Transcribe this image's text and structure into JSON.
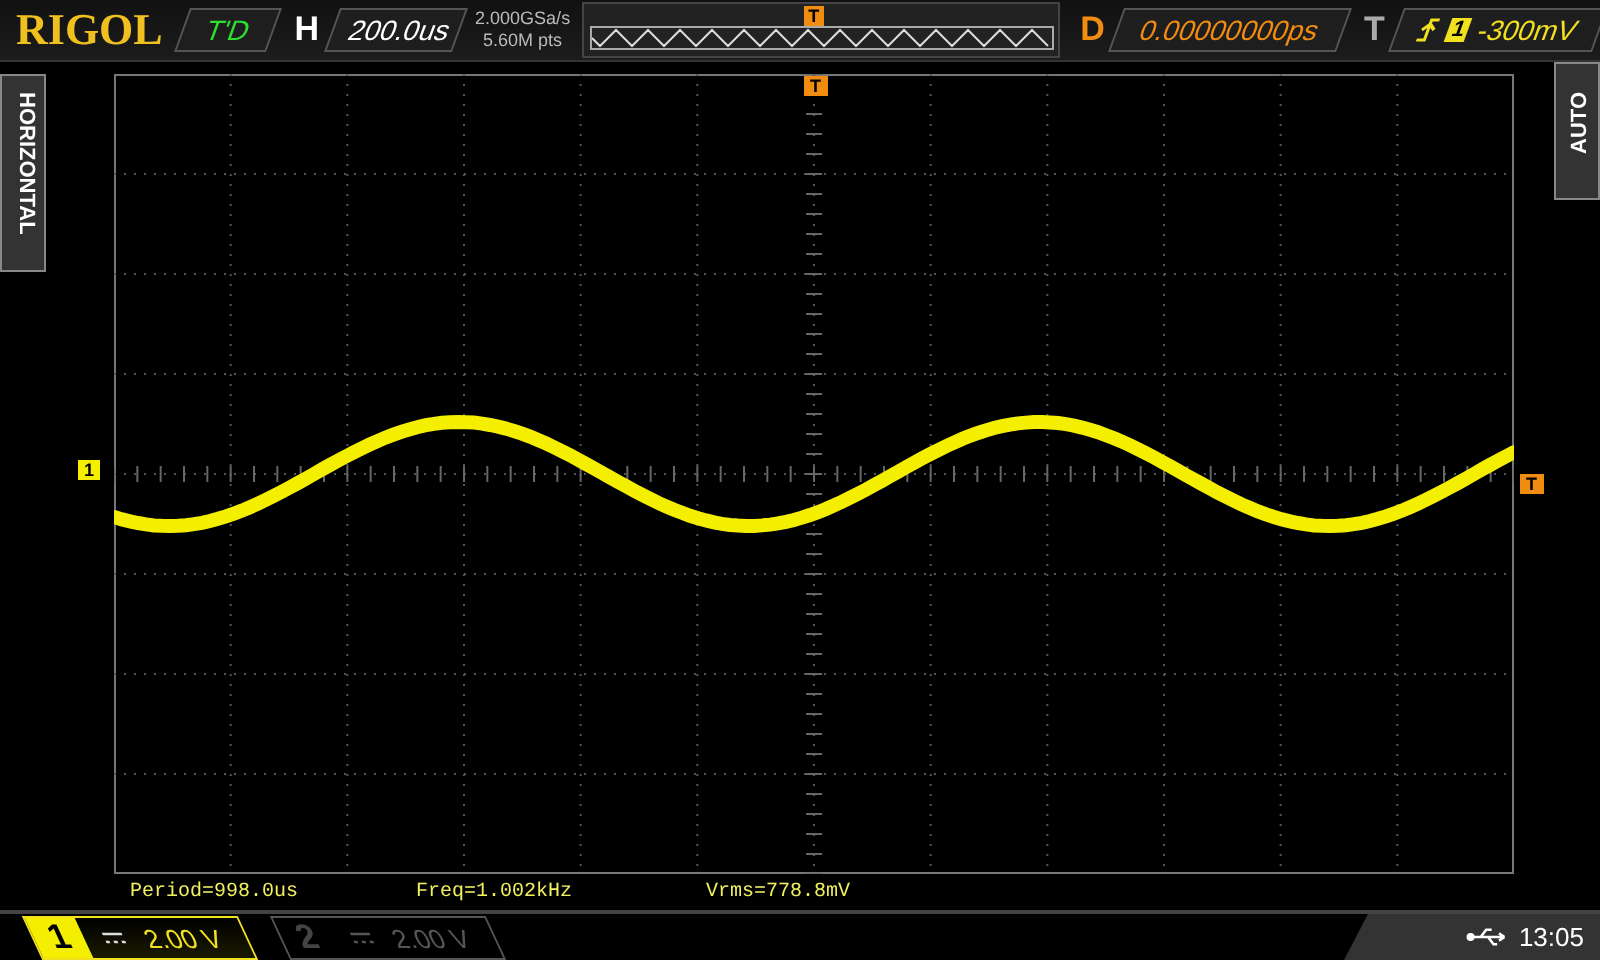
{
  "brand": "RIGOL",
  "status": {
    "run_state": "T'D",
    "horizontal_label": "H",
    "timebase": "200.0us",
    "sample_rate": "2.000GSa/s",
    "memory_depth": "5.60M pts",
    "memory_trigger_marker": "T",
    "delay_label": "D",
    "delay": "0.00000000ps",
    "trigger_label": "T",
    "trigger_channel": "1",
    "trigger_level": "-300mV"
  },
  "side_tabs": {
    "left": "HORIZONTAL",
    "right": "AUTO"
  },
  "markers": {
    "trigger_position": "T",
    "channel": "1",
    "trigger_level": "T"
  },
  "measurements": [
    "Period=998.0us",
    "Freq=1.002kHz",
    "Vrms=778.8mV"
  ],
  "channels": [
    {
      "number": "1",
      "scale": "2.00 V",
      "selected": true
    },
    {
      "number": "2",
      "scale": "2.00 V",
      "selected": false
    }
  ],
  "clock": "13:05"
}
